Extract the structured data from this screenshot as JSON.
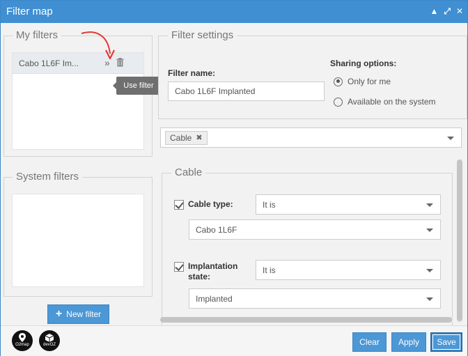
{
  "window": {
    "title": "Filter map",
    "controls": [
      "▲",
      "⤢",
      "✕"
    ]
  },
  "my_filters": {
    "legend": "My filters",
    "items": [
      {
        "name": "Cabo 1L6F Im...",
        "use_icon": "double-chevron-right-icon",
        "delete_icon": "trash-icon"
      }
    ],
    "tooltip": "Use filter"
  },
  "system_filters": {
    "legend": "System filters"
  },
  "new_filter_button": "New filter",
  "filter_settings": {
    "legend": "Filter settings",
    "name_label": "Filter name:",
    "name_value": "Cabo 1L6F Implanted",
    "sharing_label": "Sharing options:",
    "sharing": [
      {
        "label": "Only for me",
        "selected": true
      },
      {
        "label": "Available on the system",
        "selected": false
      }
    ]
  },
  "layer_select": {
    "tags": [
      "Cable"
    ]
  },
  "cable_section": {
    "legend": "Cable",
    "conditions": [
      {
        "label": "Cable type:",
        "checked": true,
        "operator": "It is",
        "value": "Cabo 1L6F"
      },
      {
        "label_line1": "Implantation",
        "label_line2": "state:",
        "checked": true,
        "operator": "It is",
        "value": "Implanted"
      }
    ]
  },
  "footer": {
    "logos": [
      "O2map",
      "devOZ"
    ],
    "buttons": {
      "clear": "Clear",
      "apply": "Apply",
      "save": "Save"
    }
  },
  "colors": {
    "accent": "#3f8fd2",
    "button": "#4c97d6",
    "tooltip": "#6f6f6f",
    "annotation_arrow": "#e53935"
  }
}
